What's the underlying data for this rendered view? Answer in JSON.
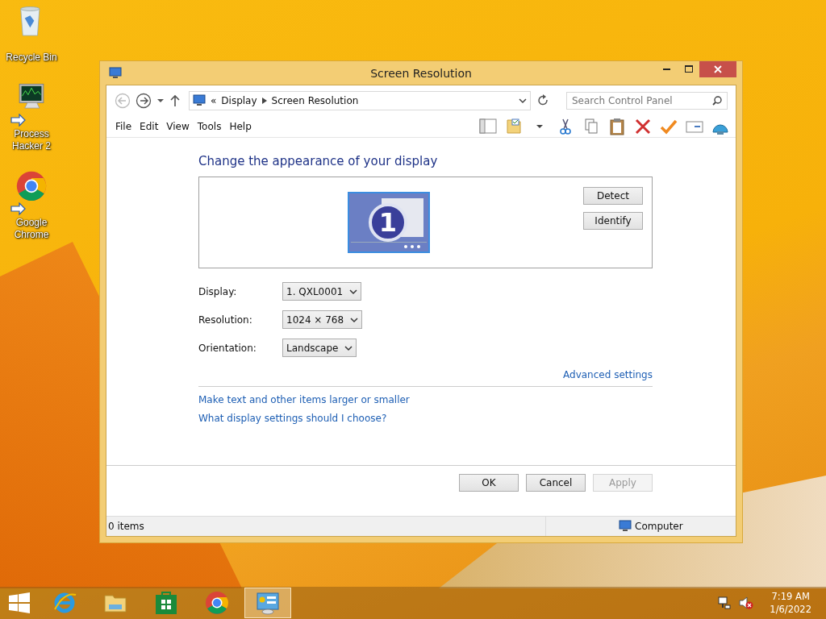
{
  "desktop_icons": [
    {
      "label": "Recycle Bin",
      "kind": "bin",
      "shortcut": false
    },
    {
      "label": "Process Hacker 2",
      "kind": "monitor",
      "shortcut": true
    },
    {
      "label": "Google Chrome",
      "kind": "chrome",
      "shortcut": true
    }
  ],
  "window": {
    "title": "Screen Resolution",
    "address": {
      "overflow": "«",
      "crumbs": [
        "Display",
        "Screen Resolution"
      ]
    },
    "search": {
      "placeholder": "Search Control Panel"
    },
    "menu": [
      "File",
      "Edit",
      "View",
      "Tools",
      "Help"
    ],
    "heading": "Change the appearance of your display",
    "monitor_number": "1",
    "side_buttons": [
      "Detect",
      "Identify"
    ],
    "fields": [
      {
        "label": "Display:",
        "value": "1. QXL0001"
      },
      {
        "label": "Resolution:",
        "value": "1024 × 768"
      },
      {
        "label": "Orientation:",
        "value": "Landscape"
      }
    ],
    "advanced_link": "Advanced settings",
    "links": [
      "Make text and other items larger or smaller",
      "What display settings should I choose?"
    ],
    "buttons": [
      {
        "label": "OK",
        "disabled": false
      },
      {
        "label": "Cancel",
        "disabled": false
      },
      {
        "label": "Apply",
        "disabled": true
      }
    ],
    "status_bar": {
      "items": "0 items",
      "location": "Computer"
    }
  },
  "taskbar": {
    "apps": [
      {
        "kind": "ie",
        "selected": false
      },
      {
        "kind": "folder",
        "selected": false
      },
      {
        "kind": "store",
        "selected": false
      },
      {
        "kind": "chrome",
        "selected": false
      },
      {
        "kind": "control",
        "selected": true
      }
    ],
    "time": "7:19 AM",
    "date": "1/6/2022"
  }
}
